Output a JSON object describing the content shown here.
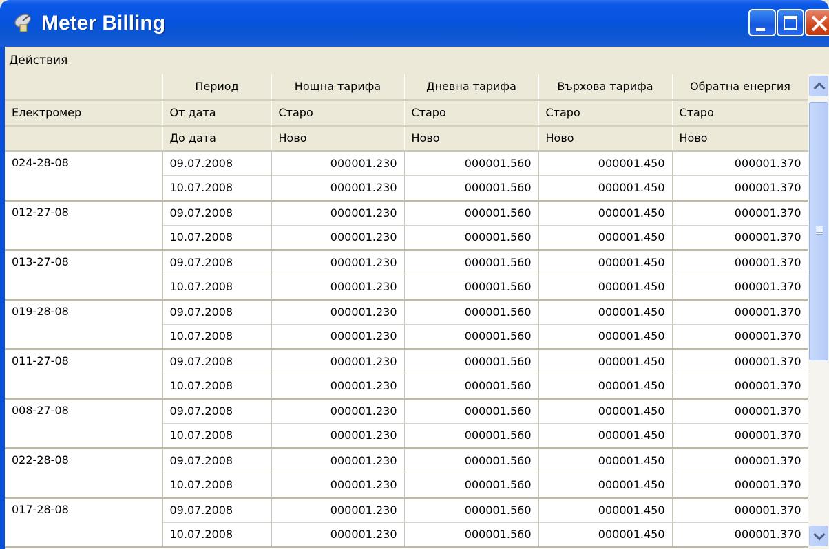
{
  "window": {
    "title": "Meter Billing",
    "icon": "satellite-dish-icon",
    "controls": [
      "minimize",
      "maximize",
      "close"
    ]
  },
  "menu": {
    "items": [
      "Действия"
    ]
  },
  "table": {
    "header_row1": [
      "",
      "Период",
      "Нощна тарифа",
      "Дневна тарифа",
      "Върхова тарифа",
      "Обратна енергия"
    ],
    "header_row2": [
      "Електромер",
      "От дата",
      "Старо",
      "Старо",
      "Старо",
      "Старо"
    ],
    "header_row3": [
      "",
      "До дата",
      "Ново",
      "Ново",
      "Ново",
      "Ново"
    ],
    "groups": [
      {
        "meter": "024-28-08",
        "rows": [
          [
            "09.07.2008",
            "000001.230",
            "000001.560",
            "000001.450",
            "000001.370"
          ],
          [
            "10.07.2008",
            "000001.230",
            "000001.560",
            "000001.450",
            "000001.370"
          ]
        ]
      },
      {
        "meter": "012-27-08",
        "rows": [
          [
            "09.07.2008",
            "000001.230",
            "000001.560",
            "000001.450",
            "000001.370"
          ],
          [
            "10.07.2008",
            "000001.230",
            "000001.560",
            "000001.450",
            "000001.370"
          ]
        ]
      },
      {
        "meter": "013-27-08",
        "rows": [
          [
            "09.07.2008",
            "000001.230",
            "000001.560",
            "000001.450",
            "000001.370"
          ],
          [
            "10.07.2008",
            "000001.230",
            "000001.560",
            "000001.450",
            "000001.370"
          ]
        ]
      },
      {
        "meter": "019-28-08",
        "rows": [
          [
            "09.07.2008",
            "000001.230",
            "000001.560",
            "000001.450",
            "000001.370"
          ],
          [
            "10.07.2008",
            "000001.230",
            "000001.560",
            "000001.450",
            "000001.370"
          ]
        ]
      },
      {
        "meter": "011-27-08",
        "rows": [
          [
            "09.07.2008",
            "000001.230",
            "000001.560",
            "000001.450",
            "000001.370"
          ],
          [
            "10.07.2008",
            "000001.230",
            "000001.560",
            "000001.450",
            "000001.370"
          ]
        ]
      },
      {
        "meter": "008-27-08",
        "rows": [
          [
            "09.07.2008",
            "000001.230",
            "000001.560",
            "000001.450",
            "000001.370"
          ],
          [
            "10.07.2008",
            "000001.230",
            "000001.560",
            "000001.450",
            "000001.370"
          ]
        ]
      },
      {
        "meter": "022-28-08",
        "rows": [
          [
            "09.07.2008",
            "000001.230",
            "000001.560",
            "000001.450",
            "000001.370"
          ],
          [
            "10.07.2008",
            "000001.230",
            "000001.560",
            "000001.450",
            "000001.370"
          ]
        ]
      },
      {
        "meter": "017-28-08",
        "rows": [
          [
            "09.07.2008",
            "000001.230",
            "000001.560",
            "000001.450",
            "000001.370"
          ],
          [
            "10.07.2008",
            "000001.230",
            "000001.560",
            "000001.450",
            "000001.370"
          ]
        ]
      }
    ]
  },
  "scrollbar": {
    "position_fraction": 0.0,
    "visible_fraction": 0.55
  }
}
